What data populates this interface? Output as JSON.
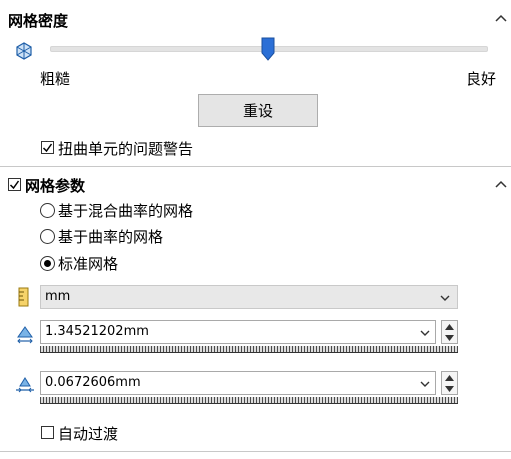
{
  "mesh_density": {
    "title": "网格密度",
    "coarse_label": "粗糙",
    "fine_label": "良好",
    "slider_value": 0.5,
    "reset_button": "重设",
    "warn_checkbox_label": "扭曲单元的问题警告",
    "warn_checked": true
  },
  "mesh_params": {
    "title": "网格参数",
    "enabled": true,
    "radio_options": [
      {
        "label": "基于混合曲率的网格",
        "selected": false
      },
      {
        "label": "基于曲率的网格",
        "selected": false
      },
      {
        "label": "标准网格",
        "selected": true
      }
    ],
    "unit_select": "mm",
    "element_size": "1.34521202mm",
    "tolerance": "0.0672606mm",
    "auto_transition_label": "自动过渡",
    "auto_transition_checked": false
  },
  "colors": {
    "accent": "#1f6fd1",
    "slider_thumb": "#2b6fd6",
    "ruler_yellow": "#e6b422"
  }
}
